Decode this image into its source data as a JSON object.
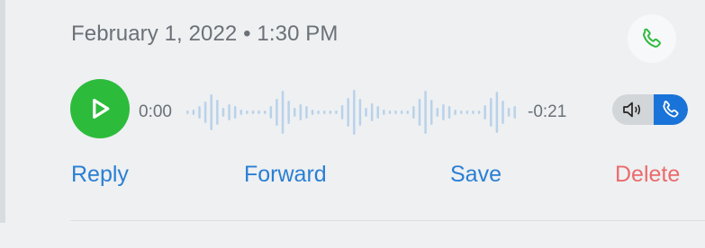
{
  "message": {
    "timestamp": "February 1, 2022 • 1:30 PM",
    "type_icon": "phone-icon"
  },
  "player": {
    "elapsed": "0:00",
    "remaining": "-0:21",
    "progress": 0,
    "play_icon": "play-icon",
    "colors": {
      "play": "#2dbb3c",
      "waveform": "#b9d2ea",
      "toggle_active": "#1a73d9"
    }
  },
  "audio_output": {
    "options": [
      "speaker-icon",
      "phone-icon"
    ],
    "selected": "phone-icon"
  },
  "actions": {
    "reply": "Reply",
    "forward": "Forward",
    "save": "Save",
    "delete": "Delete"
  }
}
